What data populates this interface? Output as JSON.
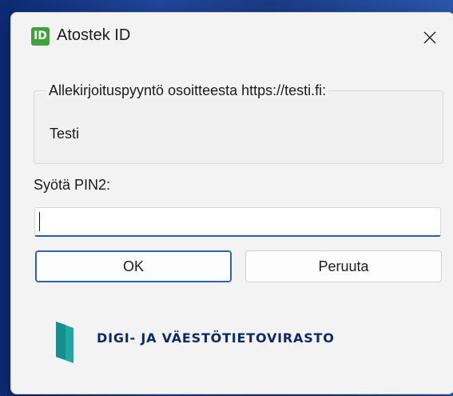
{
  "window": {
    "app_icon_text": "ID",
    "title": "Atostek ID",
    "close_label": "Close"
  },
  "request": {
    "group_title": "Allekirjoituspyyntö osoitteesta https://testi.fi:",
    "message": "Testi"
  },
  "pin": {
    "label": "Syötä PIN2:",
    "value": ""
  },
  "buttons": {
    "ok": "OK",
    "cancel": "Peruuta"
  },
  "footer": {
    "org_name": "DIGI- JA VÄESTÖTIETOVIRASTO",
    "logo_color": "#1aa9a5"
  },
  "colors": {
    "accent": "#1f5fb0",
    "app_icon": "#3fa23a"
  }
}
